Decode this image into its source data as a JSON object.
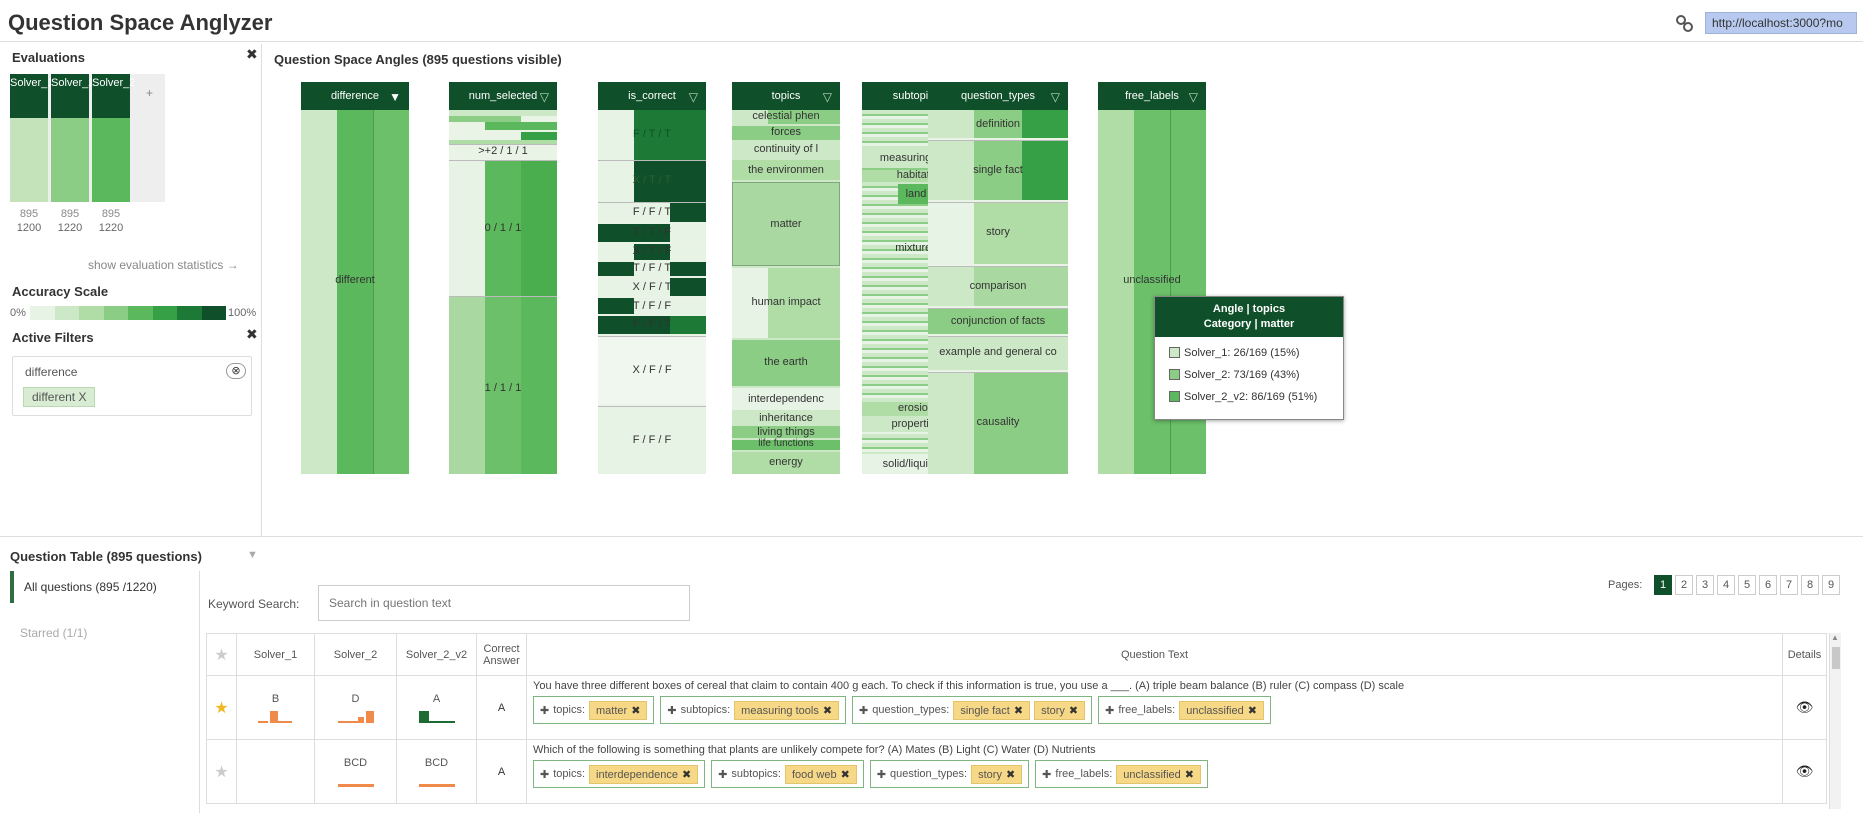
{
  "app": {
    "title": "Question Space Anglyzer",
    "url": "http://localhost:3000?mo"
  },
  "left": {
    "evaluations_title": "Evaluations",
    "solvers": [
      {
        "label": "Solver_1",
        "visible": "895",
        "total": "1200"
      },
      {
        "label": "Solver_2",
        "visible": "895",
        "total": "1220"
      },
      {
        "label": "Solver_2_v2",
        "visible": "895",
        "total": "1220"
      }
    ],
    "add_label": "+",
    "show_stats": "show evaluation statistics →",
    "accuracy_title": "Accuracy Scale",
    "accuracy_min": "0%",
    "accuracy_max": "100%",
    "accuracy_colors": [
      "#e7f3e4",
      "#cde8c6",
      "#b0dca6",
      "#8ccd85",
      "#5cb85c",
      "#36a047",
      "#1d7a36",
      "#0f4f2a"
    ],
    "filters_title": "Active Filters",
    "filter": {
      "name": "difference",
      "value": "different X",
      "remove_icon": "⊗"
    }
  },
  "angles": {
    "title": "Question Space Angles (895 questions visible)",
    "columns": [
      {
        "name": "difference",
        "labels": [
          "different"
        ]
      },
      {
        "name": "num_selected",
        "labels": [
          ">+2 / 1 / 1",
          "0 / 1 / 1",
          "1 / 1 / 1"
        ]
      },
      {
        "name": "is_correct",
        "labels": [
          "F / T / T",
          "X / T / T",
          "F / F / T",
          "T / T / F",
          "X / T / F",
          "T / F / T",
          "X / F / T",
          "T / F / F",
          "F / F / T",
          "X / F / F",
          "F / F / F"
        ]
      },
      {
        "name": "topics",
        "labels": [
          "celestial phen",
          "forces",
          "continuity of l",
          "the environmen",
          "matter",
          "human impact",
          "the earth",
          "interdependenc",
          "inheritance",
          "living things",
          "life functions",
          "energy"
        ]
      },
      {
        "name": "subtopics",
        "labels": [
          "measuring tool",
          "habitats",
          "land",
          "mixtures",
          "erosion",
          "properties",
          "solid/liquid/ga"
        ]
      },
      {
        "name": "question_types",
        "labels": [
          "definition",
          "single fact",
          "story",
          "comparison",
          "conjunction of facts",
          "example and general co",
          "causality"
        ]
      },
      {
        "name": "free_labels",
        "labels": [
          "unclassified"
        ]
      }
    ]
  },
  "tooltip": {
    "line1": "Angle | topics",
    "line2": "Category | matter",
    "rows": [
      {
        "text": "Solver_1: 26/169 (15%)",
        "color": "#cde8c6"
      },
      {
        "text": "Solver_2: 73/169 (43%)",
        "color": "#8ccd85"
      },
      {
        "text": "Solver_2_v2: 86/169 (51%)",
        "color": "#5cb85c"
      }
    ]
  },
  "table": {
    "title": "Question Table (895 questions)",
    "tabs": [
      {
        "label": "All questions (895 /1220)"
      },
      {
        "label": "Starred (1/1)"
      }
    ],
    "keyword_label": "Keyword Search:",
    "keyword_placeholder": "Search in question text",
    "pages_label": "Pages:",
    "pages": [
      "1",
      "2",
      "3",
      "4",
      "5",
      "6",
      "7",
      "8",
      "9"
    ],
    "current_page": "1",
    "headers": {
      "star": "★",
      "solver1": "Solver_1",
      "solver2": "Solver_2",
      "solver3": "Solver_2_v2",
      "correct": "Correct Answer",
      "text": "Question Text",
      "details": "Details"
    },
    "rows": [
      {
        "starred": true,
        "solver1": "B",
        "solver2": "D",
        "solver3": "A",
        "correct": "A",
        "text": "You have three different boxes of cereal that claim to contain 400 g each. To check if this information is true, you use a ___. (A) triple beam balance (B) ruler (C) compass (D) scale",
        "tags": [
          {
            "angle": "topics:",
            "values": [
              "matter"
            ]
          },
          {
            "angle": "subtopics:",
            "values": [
              "measuring tools"
            ]
          },
          {
            "angle": "question_types:",
            "values": [
              "single fact",
              "story"
            ]
          },
          {
            "angle": "free_labels:",
            "values": [
              "unclassified"
            ]
          }
        ]
      },
      {
        "starred": false,
        "solver1": "",
        "solver2": "BCD",
        "solver3": "BCD",
        "correct": "A",
        "text": "Which of the following is something that plants are unlikely compete for? (A) Mates (B) Light (C) Water (D) Nutrients",
        "tags": [
          {
            "angle": "topics:",
            "values": [
              "interdependence"
            ]
          },
          {
            "angle": "subtopics:",
            "values": [
              "food web"
            ]
          },
          {
            "angle": "question_types:",
            "values": [
              "story"
            ]
          },
          {
            "angle": "free_labels:",
            "values": [
              "unclassified"
            ]
          }
        ]
      }
    ]
  }
}
